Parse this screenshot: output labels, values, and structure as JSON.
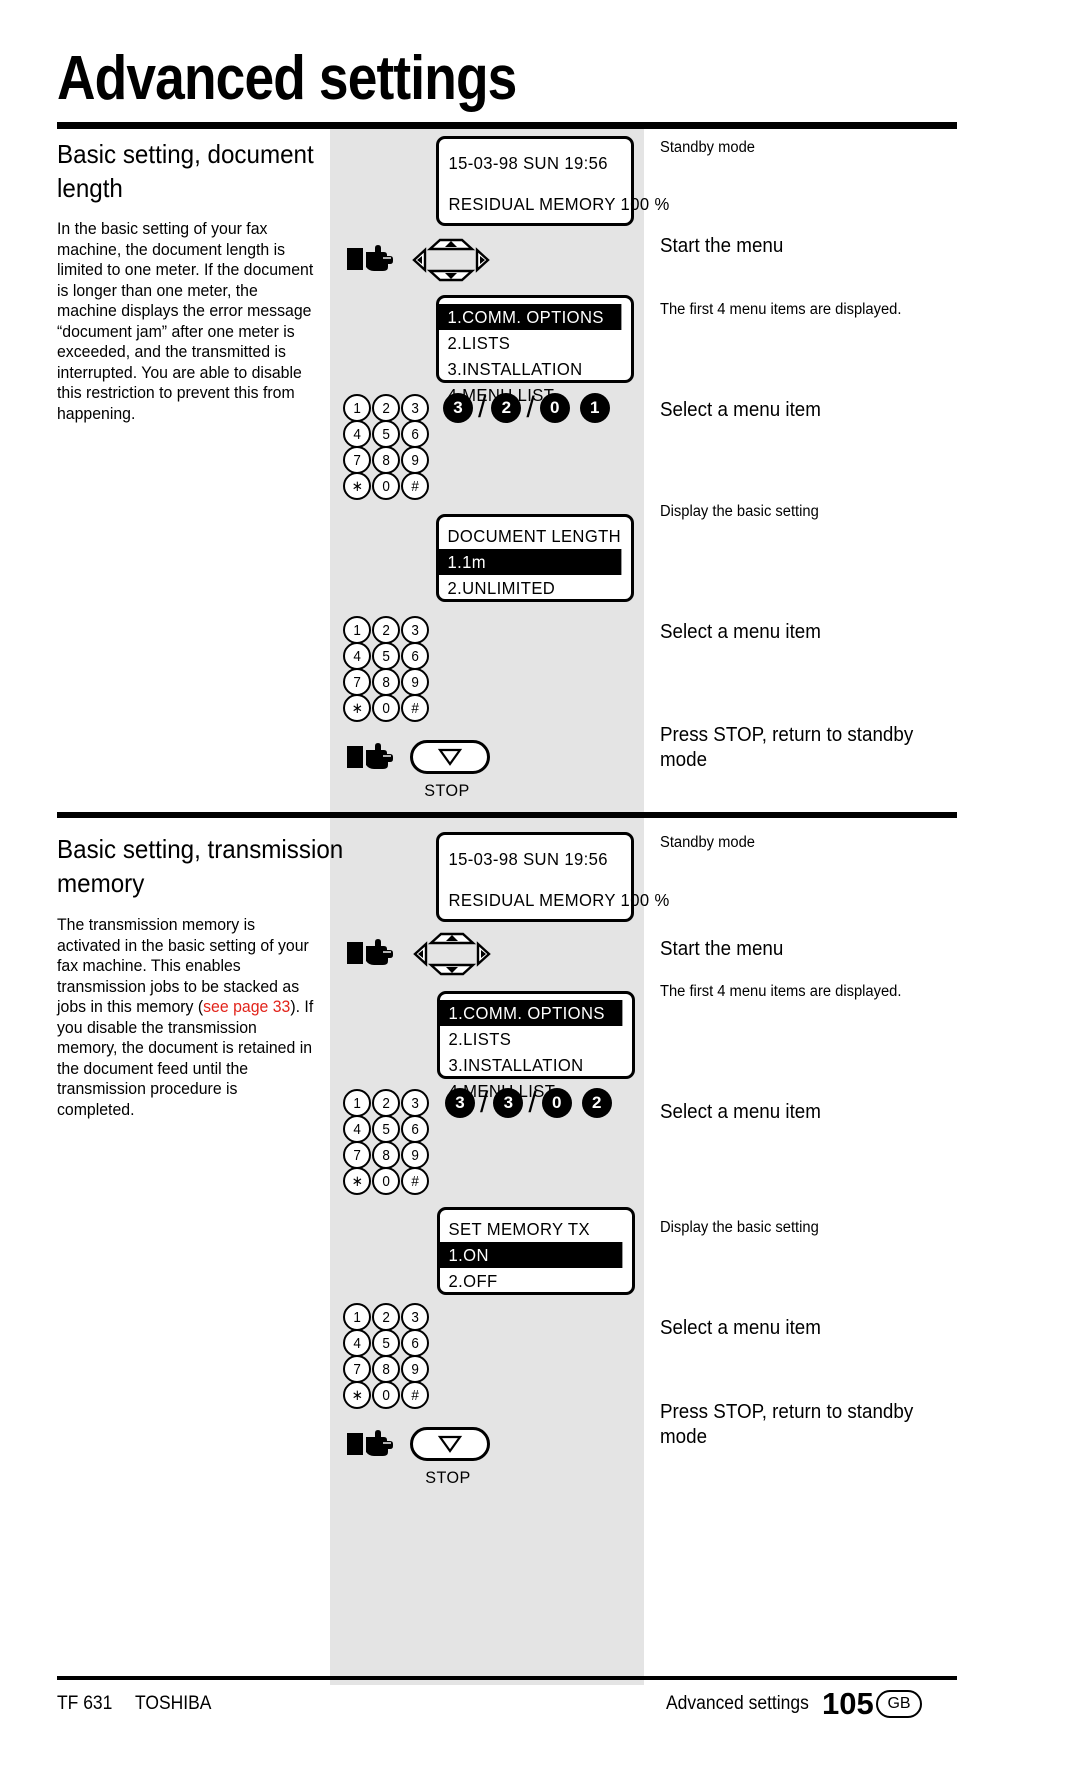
{
  "page_title": "Advanced settings",
  "sections": [
    {
      "heading": "Basic setting, document length",
      "body": "In the basic setting of your fax machine, the document length is limited to one meter. If the document is longer than one meter, the machine displays the error message “document jam” after one meter is exceeded, and the transmitted is interrupted. You are able to disable this restriction to prevent this from happening.",
      "standby": {
        "line1": "15-03-98    SUN     19:56",
        "line2": "RESIDUAL MEMORY 100 %"
      },
      "menu": {
        "items": [
          "1.COMM. OPTIONS",
          "2.LISTS",
          "3.INSTALLATION",
          "4.MENU LIST"
        ],
        "highlighted": 0
      },
      "sequence": [
        "3",
        "2",
        "0",
        "1"
      ],
      "setting": {
        "title": "DOCUMENT LENGTH",
        "items": [
          "1.1m",
          "2.UNLIMITED"
        ],
        "highlighted": 0
      },
      "stop_label": "STOP",
      "annotations": {
        "standby": "Standby mode",
        "start_menu": "Start the menu",
        "first_four": "The first 4 menu items are displayed.",
        "select1": "Select a menu item",
        "display_basic": "Display the basic setting",
        "select2": "Select a menu item",
        "press_stop": "Press STOP, return to standby mode"
      }
    },
    {
      "heading": "Basic setting, transmission memory",
      "body_pre": "The transmission memory is activated in the basic setting of your fax machine. This enables transmission jobs to be stacked as jobs in this memory (",
      "body_link": "see page 33",
      "body_post": "). If you disable the transmission memory, the document is retained in the document feed until the transmission procedure is completed.",
      "standby": {
        "line1": "15-03-98    SUN     19:56",
        "line2": "RESIDUAL MEMORY 100 %"
      },
      "menu": {
        "items": [
          "1.COMM. OPTIONS",
          "2.LISTS",
          "3.INSTALLATION",
          "4.MENU LIST"
        ],
        "highlighted": 0
      },
      "sequence": [
        "3",
        "3",
        "0",
        "2"
      ],
      "setting": {
        "title": "SET MEMORY TX",
        "items": [
          "1.ON",
          "2.OFF"
        ],
        "highlighted": 0
      },
      "stop_label": "STOP",
      "annotations": {
        "standby": "Standby mode",
        "start_menu": "Start the menu",
        "first_four": "The first 4 menu items are displayed.",
        "select1": "Select a menu item",
        "display_basic": "Display the basic setting",
        "select2": "Select a menu item",
        "press_stop": "Press STOP, return to standby mode"
      }
    }
  ],
  "keypad": {
    "rows": [
      [
        "1",
        "2",
        "3"
      ],
      [
        "4",
        "5",
        "6"
      ],
      [
        "7",
        "8",
        "9"
      ],
      [
        "∗",
        "0",
        "#"
      ]
    ]
  },
  "footer": {
    "model": "TF 631",
    "brand": "TOSHIBA",
    "section": "Advanced settings",
    "page_number": "105",
    "region": "GB"
  },
  "colors": {
    "panel": "#e4e4e4",
    "link": "#e2231a",
    "ink": "#000000"
  }
}
